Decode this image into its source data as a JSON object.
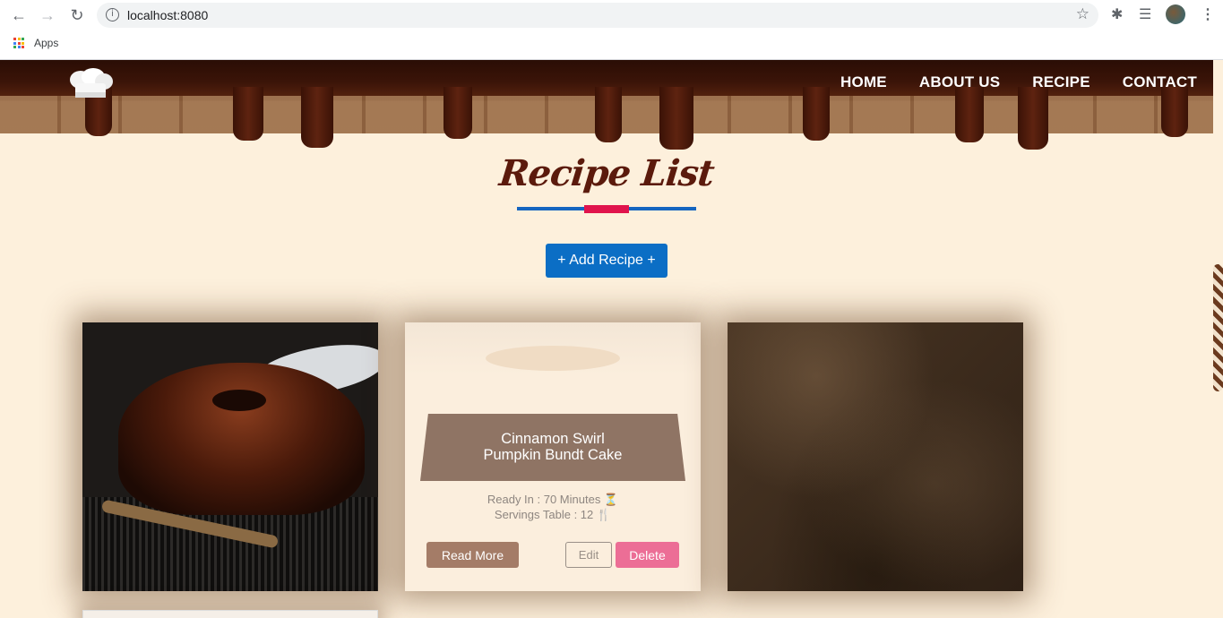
{
  "browser": {
    "url": "localhost:8080",
    "bookmarks": {
      "apps_label": "Apps"
    }
  },
  "nav": {
    "items": [
      "HOME",
      "ABOUT US",
      "RECIPE",
      "CONTACT"
    ]
  },
  "page": {
    "title": "Recipe List",
    "add_button": "+ Add Recipe +"
  },
  "cards": [
    {
      "image": "chocolate-bundt-cake-photo"
    },
    {
      "title_line1": "Cinnamon Swirl",
      "title_line2": "Pumpkin Bundt Cake",
      "ready_in": "Ready In : 70 Minutes ⏳",
      "servings": "Servings Table : 12 🍴",
      "read_more": "Read More",
      "edit": "Edit",
      "delete": "Delete"
    },
    {
      "image": "chocolate-fudge-photo"
    }
  ],
  "colors": {
    "primary_blue": "#0b6ec5",
    "accent_pink": "#e0144c",
    "title_brown": "#5b1a0c",
    "delete_pink": "#ec6e96",
    "read_more_brown": "#a47c67",
    "page_bg": "#fdf0dc"
  }
}
